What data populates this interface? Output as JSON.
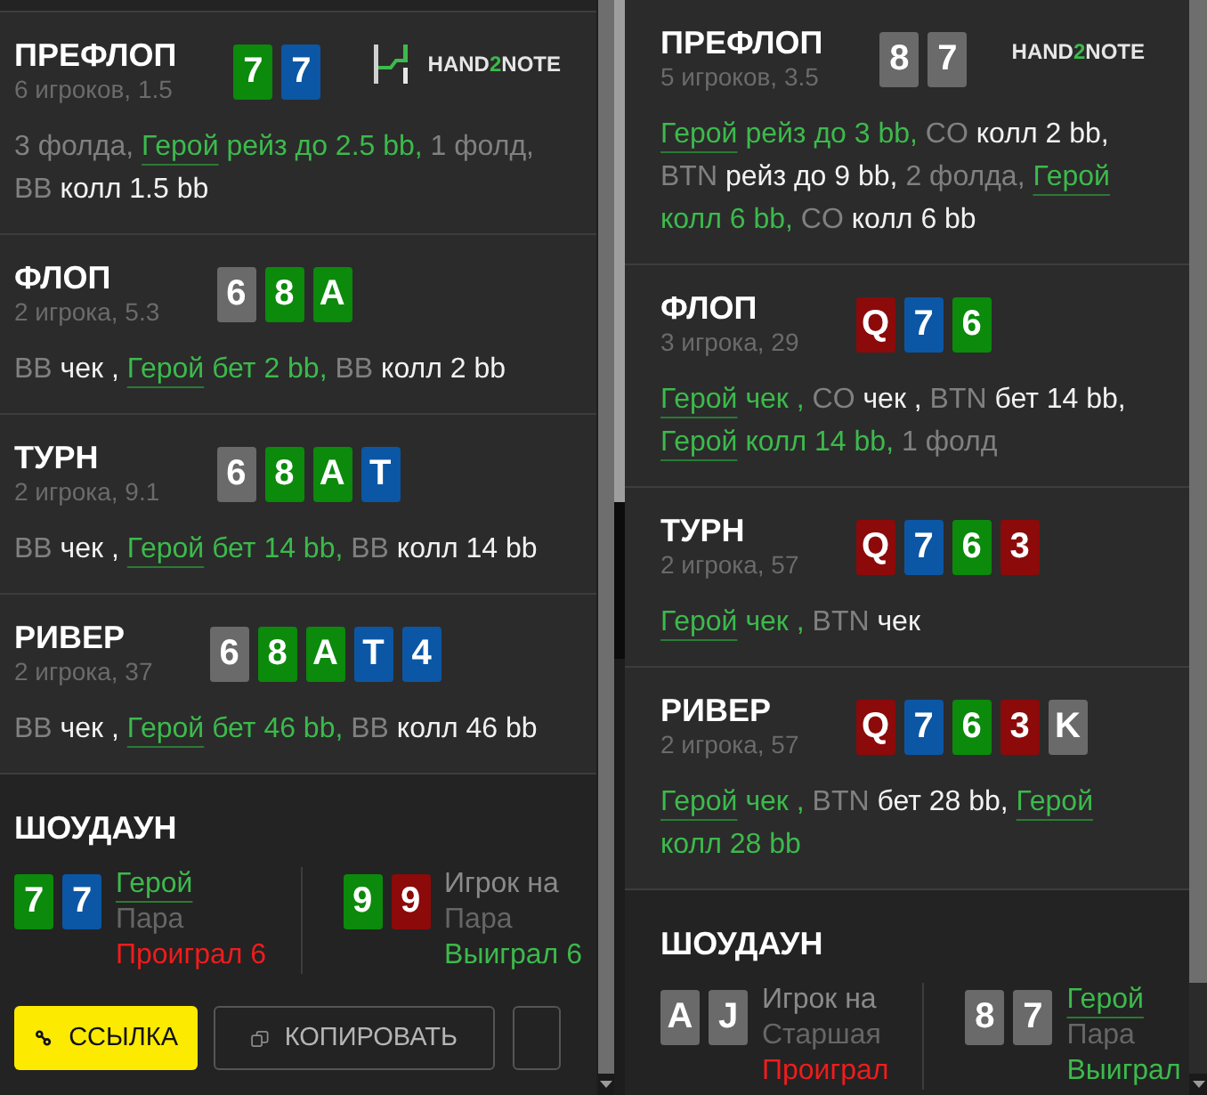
{
  "panels": [
    {
      "streets": [
        {
          "title": "ПРЕФЛОП",
          "info": "6 игроков, 1.5",
          "cards": [
            {
              "rank": "7",
              "color": "#0b8a0b"
            },
            {
              "rank": "7",
              "color": "#0b57a5"
            }
          ],
          "logo": {
            "icon": true,
            "lead": "HAND",
            "accent": "2",
            "tail": "NOTE"
          },
          "actions": [
            {
              "kind": "fold",
              "text": "3 фолда,"
            },
            {
              "kind": "hero",
              "player": "Герой",
              "action": "рейз до 2.5 bb,"
            },
            {
              "kind": "fold",
              "text": "1 фолд,"
            },
            {
              "kind": "player",
              "player": "BB",
              "action": "колл 1.5 bb"
            }
          ]
        },
        {
          "title": "ФЛОП",
          "info": "2 игрока, 5.3",
          "cards": [
            {
              "rank": "6",
              "color": "#6a6a6a"
            },
            {
              "rank": "8",
              "color": "#0b8a0b"
            },
            {
              "rank": "A",
              "color": "#0b8a0b"
            }
          ],
          "actions": [
            {
              "kind": "player",
              "player": "BB",
              "action": "чек ,"
            },
            {
              "kind": "hero",
              "player": "Герой",
              "action": "бет 2 bb,"
            },
            {
              "kind": "player",
              "player": "BB",
              "action": "колл 2 bb"
            }
          ]
        },
        {
          "title": "ТУРН",
          "info": "2 игрока, 9.1",
          "cards": [
            {
              "rank": "6",
              "color": "#6a6a6a"
            },
            {
              "rank": "8",
              "color": "#0b8a0b"
            },
            {
              "rank": "A",
              "color": "#0b8a0b"
            },
            {
              "rank": "T",
              "color": "#0b57a5"
            }
          ],
          "actions": [
            {
              "kind": "player",
              "player": "BB",
              "action": "чек ,"
            },
            {
              "kind": "hero",
              "player": "Герой",
              "action": "бет 14 bb,"
            },
            {
              "kind": "player",
              "player": "BB",
              "action": "колл 14 bb"
            }
          ]
        },
        {
          "title": "РИВЕР",
          "info": "2 игрока, 37",
          "cards": [
            {
              "rank": "6",
              "color": "#6a6a6a"
            },
            {
              "rank": "8",
              "color": "#0b8a0b"
            },
            {
              "rank": "A",
              "color": "#0b8a0b"
            },
            {
              "rank": "T",
              "color": "#0b57a5"
            },
            {
              "rank": "4",
              "color": "#0b57a5"
            }
          ],
          "actions": [
            {
              "kind": "player",
              "player": "BB",
              "action": "чек ,"
            },
            {
              "kind": "hero",
              "player": "Герой",
              "action": "бет 46 bb,"
            },
            {
              "kind": "player",
              "player": "BB",
              "action": "колл 46 bb"
            }
          ]
        }
      ],
      "showdown": {
        "title": "ШОУДАУН",
        "hands": [
          {
            "cards": [
              {
                "rank": "7",
                "color": "#0b8a0b"
              },
              {
                "rank": "7",
                "color": "#0b57a5"
              }
            ],
            "player": "Герой",
            "hero": true,
            "hand": "Пара",
            "result": "Проиграл 6",
            "won": false
          },
          {
            "cards": [
              {
                "rank": "9",
                "color": "#0b8a0b"
              },
              {
                "rank": "9",
                "color": "#8c0a0a"
              }
            ],
            "player": "Игрок на",
            "hero": false,
            "hand": "Пара",
            "result": "Выиграл 6",
            "won": true
          }
        ]
      },
      "buttons": [
        {
          "kind": "link",
          "label": "ССЫЛКА"
        },
        {
          "kind": "copy",
          "label": "КОПИРОВАТЬ"
        },
        {
          "kind": "blank"
        }
      ]
    },
    {
      "streets": [
        {
          "title": "ПРЕФЛОП",
          "info": "5 игроков, 3.5",
          "cards": [
            {
              "rank": "8",
              "color": "#6a6a6a"
            },
            {
              "rank": "7",
              "color": "#6a6a6a"
            }
          ],
          "logo": {
            "lead": "HAND",
            "accent": "2",
            "tail": "NOTE"
          },
          "actions": [
            {
              "kind": "hero",
              "player": "Герой",
              "action": "рейз до 3 bb,"
            },
            {
              "kind": "player",
              "player": "CO",
              "action": "колл 2 bb,"
            },
            {
              "kind": "player",
              "player": "BTN",
              "action": "рейз до 9 bb,"
            },
            {
              "kind": "fold",
              "text": "2 фолда,"
            },
            {
              "kind": "hero",
              "player": "Герой",
              "action": "колл 6 bb,"
            },
            {
              "kind": "player",
              "player": "CO",
              "action": "колл 6 bb"
            }
          ]
        },
        {
          "title": "ФЛОП",
          "info": "3 игрока, 29",
          "cards": [
            {
              "rank": "Q",
              "color": "#8c0a0a"
            },
            {
              "rank": "7",
              "color": "#0b57a5"
            },
            {
              "rank": "6",
              "color": "#0b8a0b"
            }
          ],
          "actions": [
            {
              "kind": "hero",
              "player": "Герой",
              "action": "чек ,"
            },
            {
              "kind": "player",
              "player": "CO",
              "action": "чек ,"
            },
            {
              "kind": "player",
              "player": "BTN",
              "action": "бет 14 bb,"
            },
            {
              "kind": "hero",
              "player": "Герой",
              "action": "колл 14 bb,"
            },
            {
              "kind": "fold",
              "text": "1 фолд"
            }
          ]
        },
        {
          "title": "ТУРН",
          "info": "2 игрока, 57",
          "cards": [
            {
              "rank": "Q",
              "color": "#8c0a0a"
            },
            {
              "rank": "7",
              "color": "#0b57a5"
            },
            {
              "rank": "6",
              "color": "#0b8a0b"
            },
            {
              "rank": "3",
              "color": "#8c0a0a"
            }
          ],
          "actions": [
            {
              "kind": "hero",
              "player": "Герой",
              "action": "чек ,"
            },
            {
              "kind": "player",
              "player": "BTN",
              "action": "чек"
            }
          ]
        },
        {
          "title": "РИВЕР",
          "info": "2 игрока, 57",
          "cards": [
            {
              "rank": "Q",
              "color": "#8c0a0a"
            },
            {
              "rank": "7",
              "color": "#0b57a5"
            },
            {
              "rank": "6",
              "color": "#0b8a0b"
            },
            {
              "rank": "3",
              "color": "#8c0a0a"
            },
            {
              "rank": "K",
              "color": "#6a6a6a"
            }
          ],
          "actions": [
            {
              "kind": "hero",
              "player": "Герой",
              "action": "чек ,"
            },
            {
              "kind": "player",
              "player": "BTN",
              "action": "бет 28 bb,"
            },
            {
              "kind": "hero",
              "player": "Герой",
              "action": "колл 28 bb"
            }
          ]
        }
      ],
      "showdown": {
        "title": "ШОУДАУН",
        "hands": [
          {
            "cards": [
              {
                "rank": "A",
                "color": "#6a6a6a"
              },
              {
                "rank": "J",
                "color": "#6a6a6a"
              }
            ],
            "player": "Игрок на",
            "hero": false,
            "hand": "Старшая",
            "result": "Проиграл",
            "won": false
          },
          {
            "cards": [
              {
                "rank": "8",
                "color": "#6a6a6a"
              },
              {
                "rank": "7",
                "color": "#6a6a6a"
              }
            ],
            "player": "Герой",
            "hero": true,
            "hand": "Пара",
            "result": "Выиграл",
            "won": true
          }
        ]
      }
    }
  ]
}
